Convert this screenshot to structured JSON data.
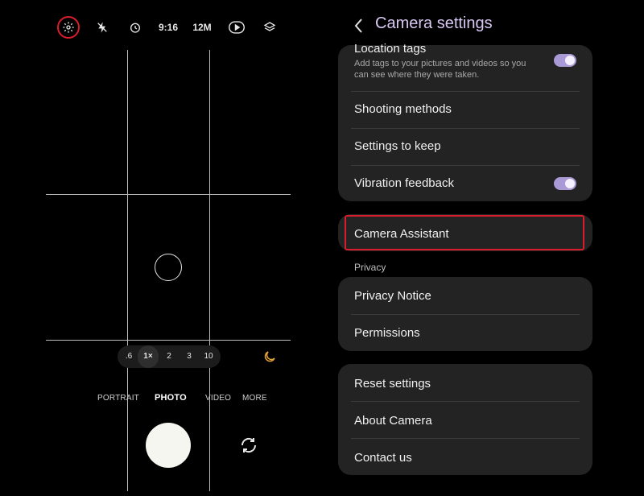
{
  "camera": {
    "topbar": {
      "timer_ratio": "9:16",
      "resolution": "12M"
    },
    "zoom": {
      "options": [
        ".6",
        "1×",
        "2",
        "3",
        "10"
      ],
      "selected": "1×"
    },
    "modes": [
      "PORTRAIT",
      "PHOTO",
      "VIDEO",
      "MORE"
    ],
    "active_mode": "PHOTO",
    "colors": {
      "highlight": "#d81e2c",
      "night": "#e8a534"
    }
  },
  "settings": {
    "title": "Camera settings",
    "group1": [
      {
        "label": "Location tags",
        "desc": "Add tags to your pictures and videos so you can see where they were taken.",
        "toggle": true
      },
      {
        "label": "Shooting methods"
      },
      {
        "label": "Settings to keep"
      },
      {
        "label": "Vibration feedback",
        "toggle": true
      }
    ],
    "camera_assistant": "Camera Assistant",
    "privacy_header": "Privacy",
    "privacy": [
      "Privacy Notice",
      "Permissions"
    ],
    "group3": [
      "Reset settings",
      "About Camera",
      "Contact us"
    ],
    "colors": {
      "title": "#d9c8f4",
      "toggle_on": "#a99ad6",
      "card": "#232323",
      "highlight": "#d81e2c"
    }
  }
}
